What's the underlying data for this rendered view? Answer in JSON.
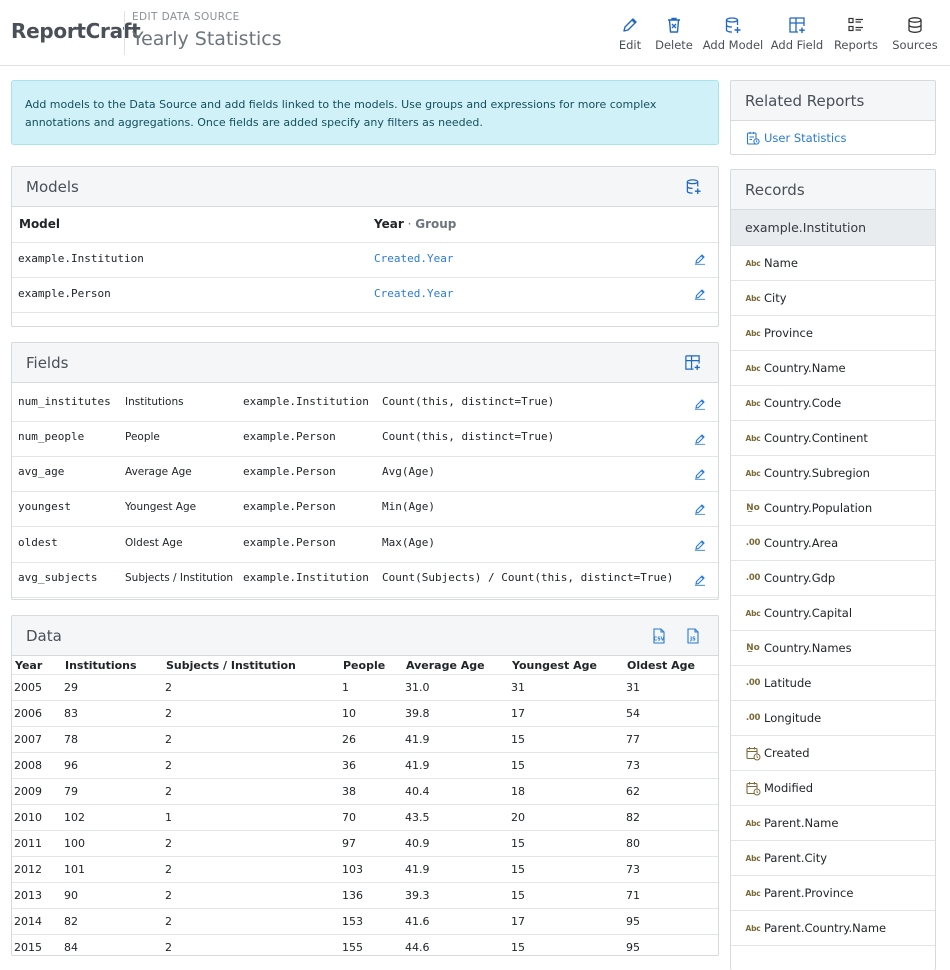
{
  "app": {
    "brand": "ReportCraft",
    "subtitle": "EDIT DATA SOURCE",
    "title": "Yearly Statistics"
  },
  "toolbar": [
    {
      "label": "Edit",
      "icon": "pencil-icon"
    },
    {
      "label": "Delete",
      "icon": "trash-icon"
    },
    {
      "label": "Add Model",
      "icon": "database-add-icon"
    },
    {
      "label": "Add Field",
      "icon": "table-add-icon"
    },
    {
      "label": "Reports",
      "icon": "list-icon"
    },
    {
      "label": "Sources",
      "icon": "database-icon"
    }
  ],
  "alert": {
    "text": "Add models to the Data Source and add fields linked to the models. Use groups and expressions for more complex annotations and aggregations. Once fields are added specify any filters as needed."
  },
  "models": {
    "title": "Models",
    "col_model": "Model",
    "col_year": "Year",
    "col_sep": "·",
    "col_group": "Group",
    "rows": [
      {
        "model": "example.Institution",
        "group": "Created.Year"
      },
      {
        "model": "example.Person",
        "group": "Created.Year"
      }
    ]
  },
  "fields": {
    "title": "Fields",
    "rows": [
      {
        "name": "num_institutes",
        "label": "Institutions",
        "model": "example.Institution",
        "expr": "Count(this, distinct=True)"
      },
      {
        "name": "num_people",
        "label": "People",
        "model": "example.Person",
        "expr": "Count(this, distinct=True)"
      },
      {
        "name": "avg_age",
        "label": "Average Age",
        "model": "example.Person",
        "expr": "Avg(Age)"
      },
      {
        "name": "youngest",
        "label": "Youngest Age",
        "model": "example.Person",
        "expr": "Min(Age)"
      },
      {
        "name": "oldest",
        "label": "Oldest Age",
        "model": "example.Person",
        "expr": "Max(Age)"
      },
      {
        "name": "avg_subjects",
        "label": "Subjects / Institution",
        "model": "example.Institution",
        "expr": "Count(Subjects) / Count(this, distinct=True)"
      }
    ]
  },
  "data": {
    "title": "Data",
    "export_csv": "CSV",
    "export_json": "JS",
    "columns": [
      "Year",
      "Institutions",
      "Subjects / Institution",
      "People",
      "Average Age",
      "Youngest Age",
      "Oldest Age"
    ],
    "rows": [
      [
        "2005",
        "29",
        "2",
        "1",
        "31.0",
        "31",
        "31"
      ],
      [
        "2006",
        "83",
        "2",
        "10",
        "39.8",
        "17",
        "54"
      ],
      [
        "2007",
        "78",
        "2",
        "26",
        "41.9",
        "15",
        "77"
      ],
      [
        "2008",
        "96",
        "2",
        "36",
        "41.9",
        "15",
        "73"
      ],
      [
        "2009",
        "79",
        "2",
        "38",
        "40.4",
        "18",
        "62"
      ],
      [
        "2010",
        "102",
        "1",
        "70",
        "43.5",
        "20",
        "82"
      ],
      [
        "2011",
        "100",
        "2",
        "97",
        "40.9",
        "15",
        "80"
      ],
      [
        "2012",
        "101",
        "2",
        "103",
        "41.9",
        "15",
        "73"
      ],
      [
        "2013",
        "90",
        "2",
        "136",
        "39.3",
        "15",
        "71"
      ],
      [
        "2014",
        "82",
        "2",
        "153",
        "41.6",
        "17",
        "95"
      ],
      [
        "2015",
        "84",
        "2",
        "155",
        "44.6",
        "15",
        "95"
      ]
    ]
  },
  "related": {
    "title": "Related Reports",
    "items": [
      {
        "label": "User Statistics"
      }
    ]
  },
  "records": {
    "title": "Records",
    "model": "example.Institution",
    "items": [
      {
        "label": "Name",
        "type": "text"
      },
      {
        "label": "City",
        "type": "text"
      },
      {
        "label": "Province",
        "type": "text"
      },
      {
        "label": "Country.Name",
        "type": "text"
      },
      {
        "label": "Country.Code",
        "type": "text"
      },
      {
        "label": "Country.Continent",
        "type": "text"
      },
      {
        "label": "Country.Subregion",
        "type": "text"
      },
      {
        "label": "Country.Population",
        "type": "number"
      },
      {
        "label": "Country.Area",
        "type": "decimal"
      },
      {
        "label": "Country.Gdp",
        "type": "decimal"
      },
      {
        "label": "Country.Capital",
        "type": "text"
      },
      {
        "label": "Country.Names",
        "type": "number"
      },
      {
        "label": "Latitude",
        "type": "decimal"
      },
      {
        "label": "Longitude",
        "type": "decimal"
      },
      {
        "label": "Created",
        "type": "date"
      },
      {
        "label": "Modified",
        "type": "date"
      },
      {
        "label": "Parent.Name",
        "type": "text"
      },
      {
        "label": "Parent.City",
        "type": "text"
      },
      {
        "label": "Parent.Province",
        "type": "text"
      },
      {
        "label": "Parent.Country.Name",
        "type": "text"
      }
    ],
    "type_badges": {
      "text": "Abc",
      "number": "N̲o",
      "decimal": ".00"
    }
  },
  "colors": {
    "accent": "#2a7bd6",
    "alert_bg": "#d1f1f9",
    "header_bg": "#f5f6f7"
  }
}
